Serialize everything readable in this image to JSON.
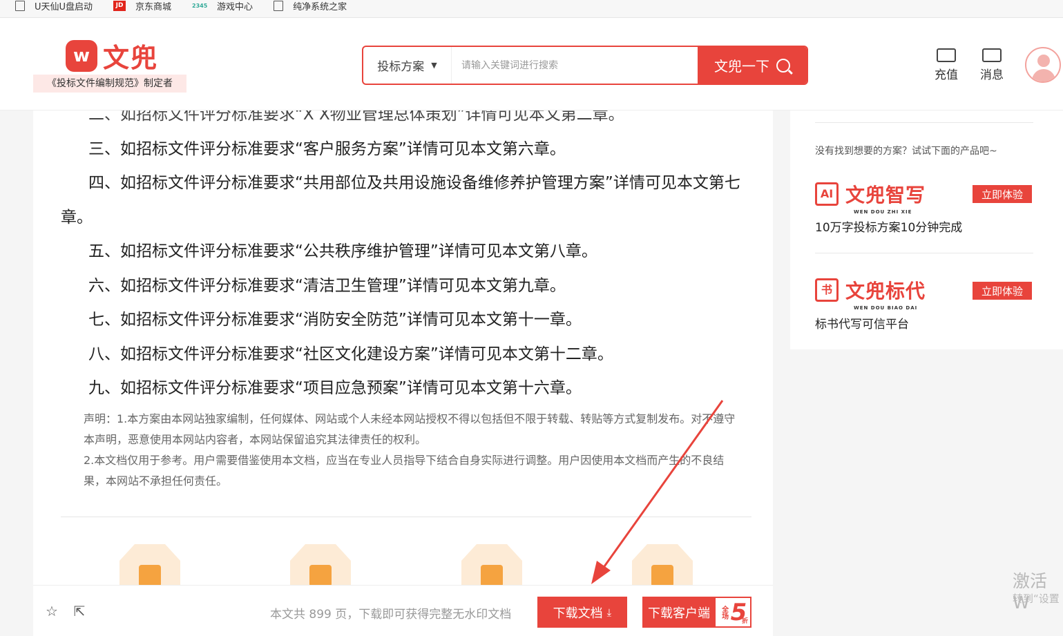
{
  "bookmarks": [
    {
      "label": "U天仙U盘启动",
      "icon": "page-icon"
    },
    {
      "label": "京东商城",
      "icon": "jd-icon"
    },
    {
      "label": "游戏中心",
      "icon": "game-icon"
    },
    {
      "label": "纯净系统之家",
      "icon": "page-icon"
    }
  ],
  "header": {
    "logo_mark": "w",
    "logo_text": "文兜",
    "logo_sub": "《投标文件编制规范》制定者",
    "search_type": "投标方案",
    "search_placeholder": "请输入关键词进行搜索",
    "search_button": "文兜一下",
    "recharge": "充值",
    "messages": "消息"
  },
  "document": {
    "lines": [
      "二、如招标文件评分标准要求“X X物业管理总体策划”详情可见本文第二章。",
      "三、如招标文件评分标准要求“客户服务方案”详情可见本文第六章。",
      "四、如招标文件评分标准要求“共用部位及共用设施设备维修养护管理方案”详情可见本文第七",
      "章。",
      "五、如招标文件评分标准要求“公共秩序维护管理”详情可见本文第八章。",
      "六、如招标文件评分标准要求“清洁卫生管理”详情可见本文第九章。",
      "七、如招标文件评分标准要求“消防安全防范”详情可见本文第十一章。",
      "八、如招标文件评分标准要求“社区文化建设方案”详情可见本文第十二章。",
      "九、如招标文件评分标准要求“项目应急预案”详情可见本文第十六章。"
    ],
    "notice_1": "声明：1.本方案由本网站独家编制，任何媒体、网站或个人未经本网站授权不得以包括但不限于转载、转贴等方式复制发布。对不遵守本声明，恶意使用本网站内容者，本网站保留追究其法律责任的权利。",
    "notice_2": "2.本文档仅用于参考。用户需要借鉴使用本文档，应当在专业人员指导下结合自身实际进行调整。用户因使用本文档而产生的不良结果，本网站不承担任何责任。"
  },
  "bottom_bar": {
    "info": "本文共 899 页，下载即可获得完整无水印文档",
    "download_button": "下载文档",
    "client_button": "下载客户端",
    "badge_small": "全场",
    "badge_big": "5",
    "badge_tiny": "折"
  },
  "sidebar": {
    "prompt": "没有找到想要的方案？试试下面的产品吧~",
    "products": [
      {
        "name": "文兜智写",
        "pinyin": "WEN DOU ZHI XIE",
        "icon_text": "AI",
        "button": "立即体验",
        "desc": "10万字投标方案10分钟完成"
      },
      {
        "name": "文兜标代",
        "pinyin": "WEN DOU BIAO DAI",
        "icon_text": "书",
        "button": "立即体验",
        "desc": "标书代写可信平台"
      }
    ]
  },
  "watermark": {
    "line1": "激活 W",
    "line2": "转到“设置"
  },
  "colors": {
    "accent": "#e8443c",
    "annotation": "#e8443c"
  }
}
